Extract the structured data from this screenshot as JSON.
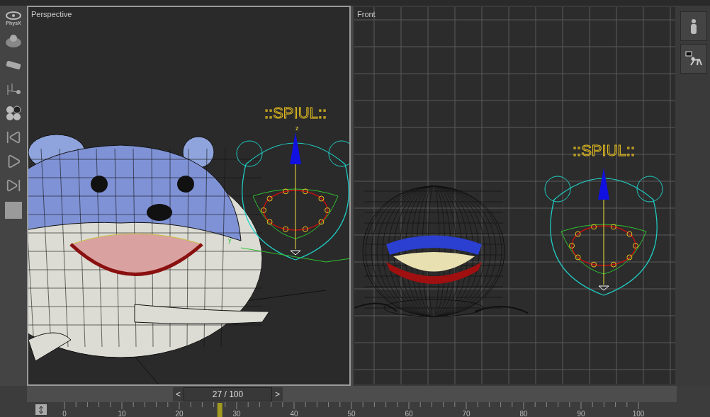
{
  "left_toolbar": {
    "logo_text": "PhysX"
  },
  "viewports": [
    {
      "label": "Perspective",
      "active": true,
      "kind": "perspective",
      "scene_text": "::SPIUL::",
      "axis_labels": [
        "z",
        "y"
      ]
    },
    {
      "label": "Front",
      "active": false,
      "kind": "front",
      "scene_text": "::SPIUL::"
    }
  ],
  "time_slider": {
    "prev": "<",
    "frame": "27 / 100",
    "next": ">",
    "level": 0.27
  },
  "timeline": {
    "labels": [
      "0",
      "10",
      "20",
      "30",
      "40",
      "50",
      "60",
      "70",
      "80",
      "90",
      "100"
    ],
    "level": 0.27
  }
}
